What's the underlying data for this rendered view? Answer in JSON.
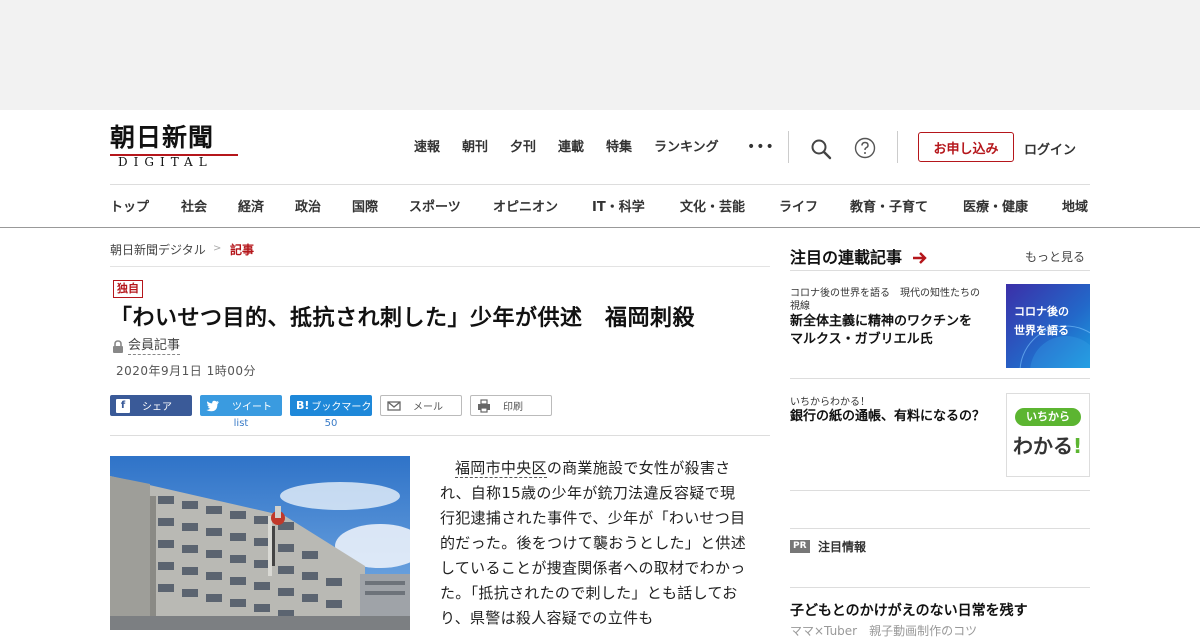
{
  "header": {
    "logo_main": "朝日新聞",
    "logo_sub": "DIGITAL",
    "top_nav": [
      "速報",
      "朝刊",
      "夕刊",
      "連載",
      "特集",
      "ランキング"
    ],
    "more": "•••",
    "apply_label": "お申し込み",
    "login_label": "ログイン"
  },
  "category_nav": [
    "トップ",
    "社会",
    "経済",
    "政治",
    "国際",
    "スポーツ",
    "オピニオン",
    "IT・科学",
    "文化・芸能",
    "ライフ",
    "教育・子育て",
    "医療・健康",
    "地域"
  ],
  "breadcrumb": {
    "home": "朝日新聞デジタル",
    "sep": ">",
    "current": "記事"
  },
  "article": {
    "badge": "独自",
    "title": "「わいせつ目的、抵抗され刺した」少年が供述　福岡刺殺",
    "member_label": "会員記事",
    "date": "2020年9月1日 1時00分",
    "share": {
      "facebook": "シェア",
      "twitter": "ツイート",
      "twitter_count": "list",
      "hatena_icon": "B!",
      "hatena": "ブックマーク",
      "hatena_count": "50",
      "mail": "メール",
      "print": "印刷"
    },
    "body_link": "福岡市中央区",
    "body_rest": "の商業施設で女性が殺害され、自称15歳の少年が銃刀法違反容疑で現行犯逮捕された事件で、少年が「わいせつ目的だった。後をつけて襲おうとした」と供述していることが捜査関係者への取材でわかった。「抵抗されたので刺した」とも話しており、県警は殺人容疑での立件も"
  },
  "sidebar": {
    "heading": "注目の連載記事",
    "more": "もっと見る",
    "cards": [
      {
        "series": "コロナ後の世界を語る　現代の知性たちの視線",
        "series_line1": "コロナ後の世界を語る　現代の知性たちの",
        "series_line2": "視線",
        "title_line1": "新全体主義に精神のワクチンを",
        "title_line2": "マルクス・ガブリエル氏",
        "thumb_line1": "コロナ後の",
        "thumb_line2": "世界を語る"
      },
      {
        "series": "いちからわかる！",
        "title_line1": "銀行の紙の通帳、有料になるの？",
        "thumb_line1": "いちから",
        "thumb_line2": "わかる",
        "thumb_mark": "!"
      }
    ],
    "pr_tag": "PR",
    "pr_label": "注目情報",
    "pr_title": "子どもとのかけがえのない日常を残す",
    "pr_sub": "ママ×Tuber　親子動画制作のコツ"
  },
  "colors": {
    "brand_red": "#b5161b",
    "facebook": "#3a5a98",
    "twitter": "#3a9be0",
    "hatena": "#1e88d9"
  }
}
